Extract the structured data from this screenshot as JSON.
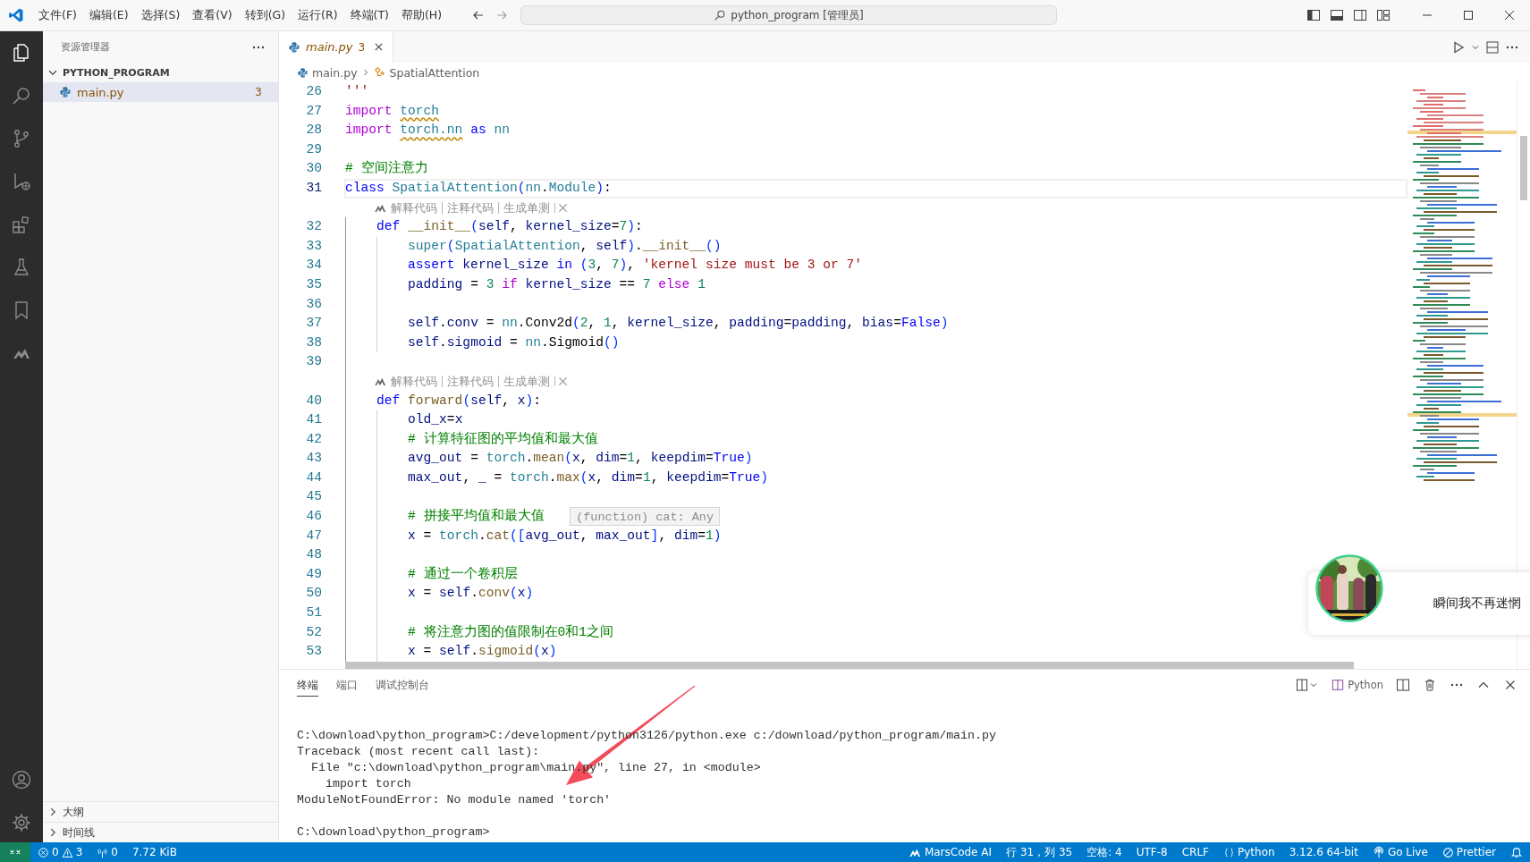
{
  "title_bar": {
    "menu": [
      "文件(F)",
      "编辑(E)",
      "选择(S)",
      "查看(V)",
      "转到(G)",
      "运行(R)",
      "终端(T)",
      "帮助(H)"
    ],
    "command_center": "python_program [管理员]"
  },
  "sidebar": {
    "title": "资源管理器",
    "folder": {
      "name": "PYTHON_PROGRAM",
      "expanded": true,
      "files": [
        {
          "name": "main.py",
          "badge": "3",
          "selected": true
        }
      ]
    },
    "sections": [
      {
        "name": "大纲",
        "expanded": false
      },
      {
        "name": "时间线",
        "expanded": false
      }
    ]
  },
  "editor": {
    "tabs": [
      {
        "name": "main.py",
        "badge": "3",
        "selected": true
      }
    ],
    "breadcrumb": [
      "main.py",
      "SpatialAttention"
    ],
    "lines": [
      {
        "kind": "code",
        "number": "26",
        "selected": false,
        "tokens": [
          {
            "text": "'''",
            "kind": "str"
          }
        ]
      },
      {
        "kind": "code",
        "number": "27",
        "selected": false,
        "tokens": [
          {
            "text": "import ",
            "kind": "ctrl"
          },
          {
            "text": "torch",
            "kind": "cls",
            "squiggle": true
          }
        ]
      },
      {
        "kind": "code",
        "number": "28",
        "selected": false,
        "tokens": [
          {
            "text": "import ",
            "kind": "ctrl"
          },
          {
            "text": "torch.nn",
            "kind": "cls",
            "squiggle": true
          },
          {
            "text": " as",
            "kind": "kw"
          },
          {
            "text": " nn",
            "kind": "cls"
          }
        ]
      },
      {
        "kind": "code",
        "number": "29",
        "selected": false
      },
      {
        "kind": "code",
        "number": "30",
        "selected": false,
        "tokens": [
          {
            "text": "# 空间注意力",
            "kind": "cmt"
          }
        ]
      },
      {
        "kind": "code",
        "number": "31",
        "selected": true,
        "tokens": [
          {
            "text": "class",
            "kind": "kw"
          },
          {
            "text": " SpatialAttention",
            "kind": "cls"
          },
          {
            "text": "(",
            "kind": "br"
          },
          {
            "text": "nn",
            "kind": "cls"
          },
          {
            "text": ".",
            "kind": "plain"
          },
          {
            "text": "Module",
            "kind": "cls"
          },
          {
            "text": ")",
            "kind": "br"
          },
          {
            "text": ":",
            "kind": "plain"
          }
        ]
      },
      {
        "kind": "codelens",
        "links": [
          "解释代码",
          "注释代码",
          "生成单测"
        ]
      },
      {
        "kind": "code",
        "number": "32",
        "selected": false,
        "tokens": [
          {
            "text": "    def",
            "kind": "kw"
          },
          {
            "text": " __init__",
            "kind": "fn"
          },
          {
            "text": "(",
            "kind": "br"
          },
          {
            "text": "self",
            "kind": "var"
          },
          {
            "text": ", ",
            "kind": "plain"
          },
          {
            "text": "kernel_size",
            "kind": "var"
          },
          {
            "text": "=",
            "kind": "plain"
          },
          {
            "text": "7",
            "kind": "num"
          },
          {
            "text": ")",
            "kind": "br"
          },
          {
            "text": ":",
            "kind": "plain"
          }
        ]
      },
      {
        "kind": "code",
        "number": "33",
        "selected": false,
        "tokens": [
          {
            "text": "        super",
            "kind": "cls"
          },
          {
            "text": "(",
            "kind": "br"
          },
          {
            "text": "SpatialAttention",
            "kind": "cls"
          },
          {
            "text": ", ",
            "kind": "plain"
          },
          {
            "text": "self",
            "kind": "var"
          },
          {
            "text": ")",
            "kind": "br"
          },
          {
            "text": ".",
            "kind": "plain"
          },
          {
            "text": "__init__",
            "kind": "fn"
          },
          {
            "text": "()",
            "kind": "br"
          }
        ]
      },
      {
        "kind": "code",
        "number": "34",
        "selected": false,
        "tokens": [
          {
            "text": "        assert",
            "kind": "kw"
          },
          {
            "text": " kernel_size",
            "kind": "var"
          },
          {
            "text": " in",
            "kind": "kw"
          },
          {
            "text": " (",
            "kind": "br"
          },
          {
            "text": "3",
            "kind": "num"
          },
          {
            "text": ", ",
            "kind": "plain"
          },
          {
            "text": "7",
            "kind": "num"
          },
          {
            "text": ")",
            "kind": "br"
          },
          {
            "text": ", ",
            "kind": "plain"
          },
          {
            "text": "'kernel size must be 3 or 7'",
            "kind": "str"
          }
        ]
      },
      {
        "kind": "code",
        "number": "35",
        "selected": false,
        "tokens": [
          {
            "text": "        padding",
            "kind": "var"
          },
          {
            "text": " = ",
            "kind": "plain"
          },
          {
            "text": "3",
            "kind": "num"
          },
          {
            "text": " if",
            "kind": "ctrl"
          },
          {
            "text": " kernel_size",
            "kind": "var"
          },
          {
            "text": " == ",
            "kind": "plain"
          },
          {
            "text": "7",
            "kind": "num"
          },
          {
            "text": " else",
            "kind": "ctrl"
          },
          {
            "text": " 1",
            "kind": "num"
          }
        ]
      },
      {
        "kind": "code",
        "number": "36",
        "selected": false
      },
      {
        "kind": "code",
        "number": "37",
        "selected": false,
        "tokens": [
          {
            "text": "        self",
            "kind": "var"
          },
          {
            "text": ".",
            "kind": "plain"
          },
          {
            "text": "conv",
            "kind": "var"
          },
          {
            "text": " = ",
            "kind": "plain"
          },
          {
            "text": "nn",
            "kind": "cls"
          },
          {
            "text": ".",
            "kind": "plain"
          },
          {
            "text": "Conv2d",
            "kind": "plain"
          },
          {
            "text": "(",
            "kind": "br"
          },
          {
            "text": "2",
            "kind": "num"
          },
          {
            "text": ", ",
            "kind": "plain"
          },
          {
            "text": "1",
            "kind": "num"
          },
          {
            "text": ", ",
            "kind": "plain"
          },
          {
            "text": "kernel_size",
            "kind": "var"
          },
          {
            "text": ", ",
            "kind": "plain"
          },
          {
            "text": "padding",
            "kind": "var"
          },
          {
            "text": "=",
            "kind": "plain"
          },
          {
            "text": "padding",
            "kind": "var"
          },
          {
            "text": ", ",
            "kind": "plain"
          },
          {
            "text": "bias",
            "kind": "var"
          },
          {
            "text": "=",
            "kind": "plain"
          },
          {
            "text": "False",
            "kind": "kw"
          },
          {
            "text": ")",
            "kind": "br"
          }
        ]
      },
      {
        "kind": "code",
        "number": "38",
        "selected": false,
        "tokens": [
          {
            "text": "        self",
            "kind": "var"
          },
          {
            "text": ".",
            "kind": "plain"
          },
          {
            "text": "sigmoid",
            "kind": "var"
          },
          {
            "text": " = ",
            "kind": "plain"
          },
          {
            "text": "nn",
            "kind": "cls"
          },
          {
            "text": ".",
            "kind": "plain"
          },
          {
            "text": "Sigmoid",
            "kind": "plain"
          },
          {
            "text": "()",
            "kind": "br"
          }
        ]
      },
      {
        "kind": "code",
        "number": "39",
        "selected": false
      },
      {
        "kind": "codelens",
        "links": [
          "解释代码",
          "注释代码",
          "生成单测"
        ]
      },
      {
        "kind": "code",
        "number": "40",
        "selected": false,
        "tokens": [
          {
            "text": "    def",
            "kind": "kw"
          },
          {
            "text": " forward",
            "kind": "fn"
          },
          {
            "text": "(",
            "kind": "br"
          },
          {
            "text": "self",
            "kind": "var"
          },
          {
            "text": ", ",
            "kind": "plain"
          },
          {
            "text": "x",
            "kind": "var"
          },
          {
            "text": ")",
            "kind": "br"
          },
          {
            "text": ":",
            "kind": "plain"
          }
        ]
      },
      {
        "kind": "code",
        "number": "41",
        "selected": false,
        "tokens": [
          {
            "text": "        old_x",
            "kind": "var"
          },
          {
            "text": "=",
            "kind": "plain"
          },
          {
            "text": "x",
            "kind": "var"
          }
        ]
      },
      {
        "kind": "code",
        "number": "42",
        "selected": false,
        "tokens": [
          {
            "text": "        # 计算特征图的平均值和最大值",
            "kind": "cmt"
          }
        ]
      },
      {
        "kind": "code",
        "number": "43",
        "selected": false,
        "tokens": [
          {
            "text": "        avg_out",
            "kind": "var"
          },
          {
            "text": " = ",
            "kind": "plain"
          },
          {
            "text": "torch",
            "kind": "cls"
          },
          {
            "text": ".",
            "kind": "plain"
          },
          {
            "text": "mean",
            "kind": "fn"
          },
          {
            "text": "(",
            "kind": "br"
          },
          {
            "text": "x",
            "kind": "var"
          },
          {
            "text": ", ",
            "kind": "plain"
          },
          {
            "text": "dim",
            "kind": "var"
          },
          {
            "text": "=",
            "kind": "plain"
          },
          {
            "text": "1",
            "kind": "num"
          },
          {
            "text": ", ",
            "kind": "plain"
          },
          {
            "text": "keepdim",
            "kind": "var"
          },
          {
            "text": "=",
            "kind": "plain"
          },
          {
            "text": "True",
            "kind": "kw"
          },
          {
            "text": ")",
            "kind": "br"
          }
        ]
      },
      {
        "kind": "code",
        "number": "44",
        "selected": false,
        "tokens": [
          {
            "text": "        max_out",
            "kind": "var"
          },
          {
            "text": ", ",
            "kind": "plain"
          },
          {
            "text": "_",
            "kind": "var"
          },
          {
            "text": " = ",
            "kind": "plain"
          },
          {
            "text": "torch",
            "kind": "cls"
          },
          {
            "text": ".",
            "kind": "plain"
          },
          {
            "text": "max",
            "kind": "fn"
          },
          {
            "text": "(",
            "kind": "br"
          },
          {
            "text": "x",
            "kind": "var"
          },
          {
            "text": ", ",
            "kind": "plain"
          },
          {
            "text": "dim",
            "kind": "var"
          },
          {
            "text": "=",
            "kind": "plain"
          },
          {
            "text": "1",
            "kind": "num"
          },
          {
            "text": ", ",
            "kind": "plain"
          },
          {
            "text": "keepdim",
            "kind": "var"
          },
          {
            "text": "=",
            "kind": "plain"
          },
          {
            "text": "True",
            "kind": "kw"
          },
          {
            "text": ")",
            "kind": "br"
          }
        ]
      },
      {
        "kind": "code",
        "number": "45",
        "selected": false
      },
      {
        "kind": "code",
        "number": "46",
        "selected": false,
        "hover": "(function) cat: Any",
        "tokens": [
          {
            "text": "        # 拼接平均值和最大值",
            "kind": "cmt"
          }
        ]
      },
      {
        "kind": "code",
        "number": "47",
        "selected": false,
        "tokens": [
          {
            "text": "        x",
            "kind": "var"
          },
          {
            "text": " = ",
            "kind": "plain"
          },
          {
            "text": "torch",
            "kind": "cls"
          },
          {
            "text": ".",
            "kind": "plain"
          },
          {
            "text": "cat",
            "kind": "fn"
          },
          {
            "text": "([",
            "kind": "br"
          },
          {
            "text": "avg_out",
            "kind": "var"
          },
          {
            "text": ", ",
            "kind": "plain"
          },
          {
            "text": "max_out",
            "kind": "var"
          },
          {
            "text": "]",
            "kind": "br"
          },
          {
            "text": ", ",
            "kind": "plain"
          },
          {
            "text": "dim",
            "kind": "var"
          },
          {
            "text": "=",
            "kind": "plain"
          },
          {
            "text": "1",
            "kind": "num"
          },
          {
            "text": ")",
            "kind": "br"
          }
        ]
      },
      {
        "kind": "code",
        "number": "48",
        "selected": false
      },
      {
        "kind": "code",
        "number": "49",
        "selected": false,
        "tokens": [
          {
            "text": "        # 通过一个卷积层",
            "kind": "cmt"
          }
        ]
      },
      {
        "kind": "code",
        "number": "50",
        "selected": false,
        "tokens": [
          {
            "text": "        x",
            "kind": "var"
          },
          {
            "text": " = ",
            "kind": "plain"
          },
          {
            "text": "self",
            "kind": "var"
          },
          {
            "text": ".",
            "kind": "plain"
          },
          {
            "text": "conv",
            "kind": "fn"
          },
          {
            "text": "(",
            "kind": "br"
          },
          {
            "text": "x",
            "kind": "var"
          },
          {
            "text": ")",
            "kind": "br"
          }
        ]
      },
      {
        "kind": "code",
        "number": "51",
        "selected": false
      },
      {
        "kind": "code",
        "number": "52",
        "selected": false,
        "tokens": [
          {
            "text": "        # 将注意力图的值限制在0和1之间",
            "kind": "cmt"
          }
        ]
      },
      {
        "kind": "code",
        "number": "53",
        "selected": false,
        "tokens": [
          {
            "text": "        x",
            "kind": "var"
          },
          {
            "text": " = ",
            "kind": "plain"
          },
          {
            "text": "self",
            "kind": "var"
          },
          {
            "text": ".",
            "kind": "plain"
          },
          {
            "text": "sigmoid",
            "kind": "fn"
          },
          {
            "text": "(",
            "kind": "br"
          },
          {
            "text": "x",
            "kind": "var"
          },
          {
            "text": ")",
            "kind": "br"
          }
        ]
      }
    ]
  },
  "panel": {
    "tabs": [
      {
        "label": "终端",
        "selected": true
      },
      {
        "label": "端口",
        "selected": false
      },
      {
        "label": "调试控制台",
        "selected": false
      }
    ],
    "terminal_name": "Python",
    "output": [
      "C:\\download\\python_program>C:/development/python3126/python.exe c:/download/python_program/main.py",
      "Traceback (most recent call last):",
      "  File \"c:\\download\\python_program\\main.py\", line 27, in <module>",
      "    import torch",
      "ModuleNotFoundError: No module named 'torch'"
    ],
    "prompt": "C:\\download\\python_program>"
  },
  "status_bar": {
    "errors": "0",
    "warnings": "3",
    "ports": "0",
    "file_size": "7.72 KiB",
    "right": [
      {
        "kind": "marscode",
        "text": "MarsCode AI"
      },
      {
        "kind": "text",
        "text": "行 31，列 35"
      },
      {
        "kind": "text",
        "text": "空格: 4"
      },
      {
        "kind": "text",
        "text": "UTF-8"
      },
      {
        "kind": "text",
        "text": "CRLF"
      },
      {
        "kind": "language",
        "text": "Python"
      },
      {
        "kind": "text",
        "text": "3.12.6 64-bit"
      },
      {
        "kind": "live",
        "text": "Go Live"
      },
      {
        "kind": "prettier",
        "text": "Prettier"
      },
      {
        "kind": "bell"
      }
    ]
  },
  "notification": {
    "text": "瞬间我不再迷惘"
  }
}
